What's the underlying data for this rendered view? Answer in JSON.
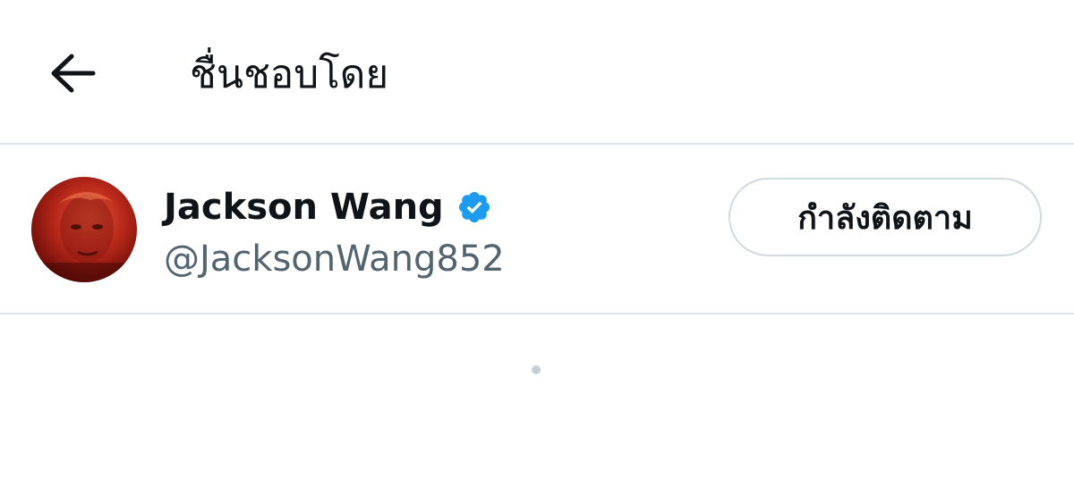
{
  "header": {
    "back_icon": "arrow-left-icon",
    "title": "ชื่นชอบโดย"
  },
  "users": [
    {
      "display_name": "Jackson Wang",
      "handle": "@JacksonWang852",
      "verified": true,
      "verified_icon": "verified-badge-icon",
      "follow_button_label": "กำลังติดตาม"
    }
  ],
  "colors": {
    "verified_badge": "#1d9bf0",
    "handle_text": "#536471",
    "divider": "#e1e4e8",
    "button_border": "#cfd9de",
    "loader": "#c4cfd6"
  }
}
